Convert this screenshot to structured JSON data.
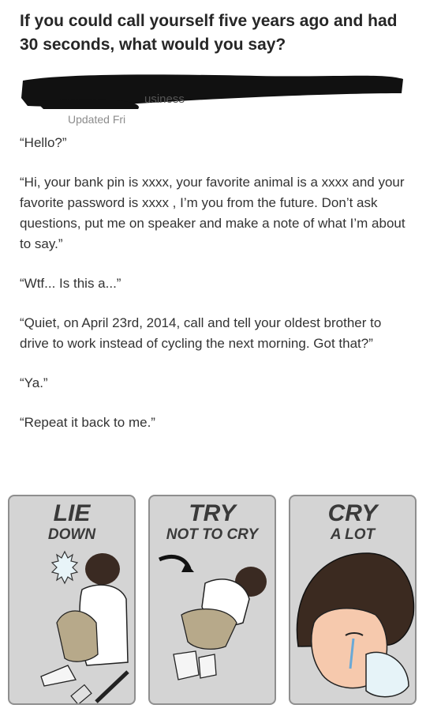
{
  "question": "If you could call yourself five years ago and had 30 seconds, what would you say?",
  "author": {
    "visible_fragment": "usiness"
  },
  "meta": {
    "updated": "Updated Fri"
  },
  "answer": {
    "paragraphs": [
      "“Hello?”",
      "“Hi, your bank pin is xxxx, your favorite animal is a xxxx and your favorite password is xxxx , I’m you from the future. Don’t ask questions, put me on speaker and make a note of what I’m about to say.”",
      "“Wtf... Is this a...”",
      "“Quiet, on April 23rd, 2014, call and tell your oldest brother to drive to work instead of cycling the next morning. Got that?”",
      "“Ya.”",
      "“Repeat it back to me.”"
    ]
  },
  "meme": {
    "panels": [
      {
        "line1": "LIE",
        "line2": "DOWN"
      },
      {
        "line1": "TRY",
        "line2": "NOT TO CRY"
      },
      {
        "line1": "CRY",
        "line2": "A LOT"
      }
    ]
  }
}
